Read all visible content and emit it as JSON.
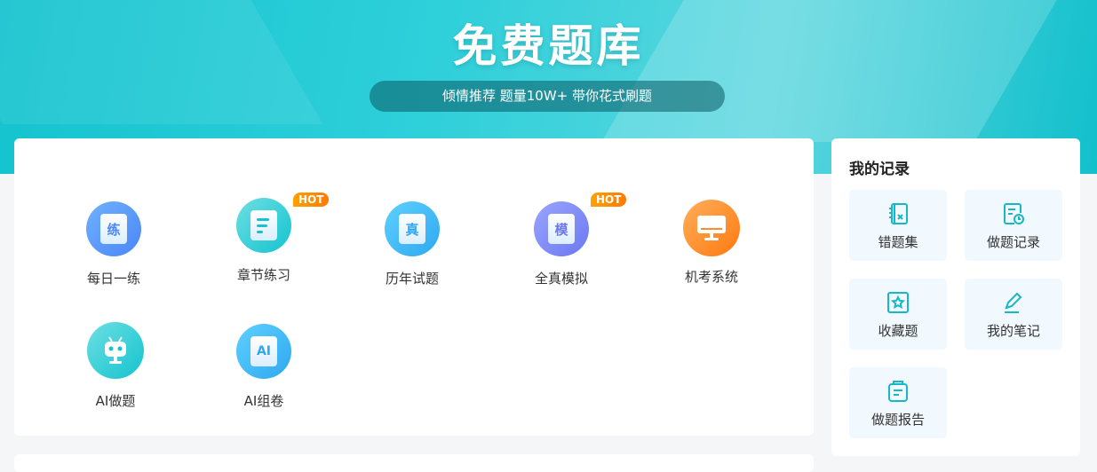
{
  "banner": {
    "title": "免费题库",
    "subtitle": "倾情推荐 题量10W+ 带你花式刷题"
  },
  "features": [
    {
      "label": "每日一练",
      "glyph": "练",
      "hot": false,
      "icon": "practice-scroll-icon"
    },
    {
      "label": "章节练习",
      "glyph": "",
      "hot": true,
      "icon": "document-icon"
    },
    {
      "label": "历年试题",
      "glyph": "真",
      "hot": false,
      "icon": "past-exam-scroll-icon"
    },
    {
      "label": "全真模拟",
      "glyph": "模",
      "hot": true,
      "icon": "mock-exam-scroll-icon"
    },
    {
      "label": "机考系统",
      "glyph": "",
      "hot": false,
      "icon": "computer-icon"
    },
    {
      "label": "AI做题",
      "glyph": "",
      "hot": false,
      "icon": "robot-icon"
    },
    {
      "label": "AI组卷",
      "glyph": "AI",
      "hot": false,
      "icon": "ai-scroll-icon"
    }
  ],
  "hot_label": "HOT",
  "records": {
    "title": "我的记录",
    "items": [
      {
        "label": "错题集",
        "icon": "wrong-notebook-icon"
      },
      {
        "label": "做题记录",
        "icon": "history-clock-icon"
      },
      {
        "label": "收藏题",
        "icon": "star-icon"
      },
      {
        "label": "我的笔记",
        "icon": "pencil-icon"
      },
      {
        "label": "做题报告",
        "icon": "report-clipboard-icon"
      }
    ]
  },
  "colors": {
    "accent": "#14c3cf",
    "hot": "#ff8a00"
  }
}
